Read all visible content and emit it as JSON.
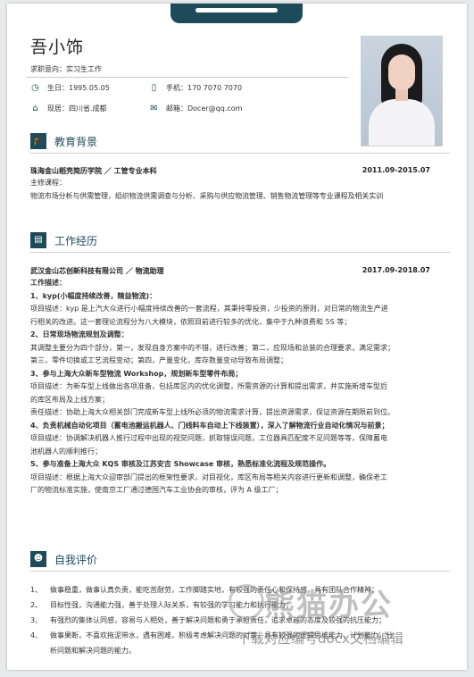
{
  "header": {
    "name": "吾小饰",
    "intent": "求职意向：实习生工作",
    "birthday": "生日：1995.05.05",
    "phone": "手机：170 7070 7070",
    "location": "现居：四川省.成都",
    "email": "邮箱：Docer@qq.com",
    "icons": [
      "clock-icon",
      "phone-icon",
      "home-icon",
      "mail-icon"
    ]
  },
  "education": {
    "title": "教育背景",
    "school": "珠海金山稻壳简历学院 ／ 工管专业本科",
    "date": "2011.09-2015.07",
    "courses_label": "主修课程：",
    "courses": "物流市场分析与供需管理，组织物流供需调查与分析、采购与供应物流管理、销售物流管理等专业课程及相关实训"
  },
  "work": {
    "title": "工作经历",
    "company": "武汉金山芯创新科技有限公司 ／ 物流助理",
    "date": "2017.09-2018.07",
    "desc_label": "工作描述：",
    "lines": [
      "1、kyp(小幅度持续改善，精益物流)：",
      "项目描述：kyp 是上汽大众进行小幅度持续改善的一套流程，其秉持零投资，少投资的原则，对日常的物流生产进",
      "行相关的改进。这一套理论流程分为八大模块，依照目前进行较多的优化，集中于九种浪费和 5S 等；",
      "2、日常现场物流规划及调整：",
      "其调整主要分为四个部分，第一，发现自身方案中的不错，进行改善；第二，应现场和总装的合理要求，满足需求；",
      "第三，零件切换或工艺流程变动；第四，产量变化，库存数量变动导致布局调整；",
      "3、参与上海大众新车型物流 Workshop，规划新车型零件布局；",
      "项目描述：为新车型上线做出各项准备，包括库区内的优化调整，所需资源的计算和提出需求，并实施新增车型后",
      "的库区布局及上线方案；",
      "责任描述：协助上海大众相关部门完成新车型上线所必须的物流需求计算，提出资源需求，保证资源在期限前到位。",
      "4、负责机械自动化项目（蓄电池搬运机器人、门线料车自动上下线装置），深入了解物流行业自动化情况与前景；",
      "项目描述：协调解决机器人推行过程中出现的视觉问题，抓取错误问题，工位器具匹配度不足问题等等，保障蓄电",
      "池机器人的顺利推行；",
      "5、参与准备上海大众 KQS 审核及江苏安吉 Showcase 审核，熟悉标准化流程及规范操作。",
      "项目描述：根据上海大众迎审部门提出的框架性要求，对目视化，库区布局等相关内容进行更新和调整，确保老工",
      "厂的物流标准实施，使南京工厂通过德国汽车工业协会的审核，评为 A 级工厂；"
    ]
  },
  "evaluation": {
    "title": "自我评价",
    "items": [
      {
        "num": "1、",
        "text": "做事稳重，做事认真负责，能吃苦耐劳，工作脚踏实地，有较强的责任心和保持感，具有团队合作精神；"
      },
      {
        "num": "2、",
        "text": "目标性强，沟通能力强，善于处理人际关系，有较强的学习能力和执行能力；"
      },
      {
        "num": "3、",
        "text": "有强烈的集体认同感，容易与人相处，善于解决问题和勇于承担责任，追求卓越的态度及较强的抗压能力；"
      },
      {
        "num": "4、",
        "text": "做事果断，不喜欢拖泥带水，遇有困难，积极考虑解决问题的对策，具有较强的逻辑思维能力，计划能力，分"
      },
      {
        "num": "",
        "text": "析问题和解决问题的能力。"
      }
    ]
  },
  "watermark": {
    "title": "熊猫办公",
    "subtitle": "下载对应编号docx文档编辑"
  },
  "colors": {
    "accent": "#1e4b5a"
  }
}
